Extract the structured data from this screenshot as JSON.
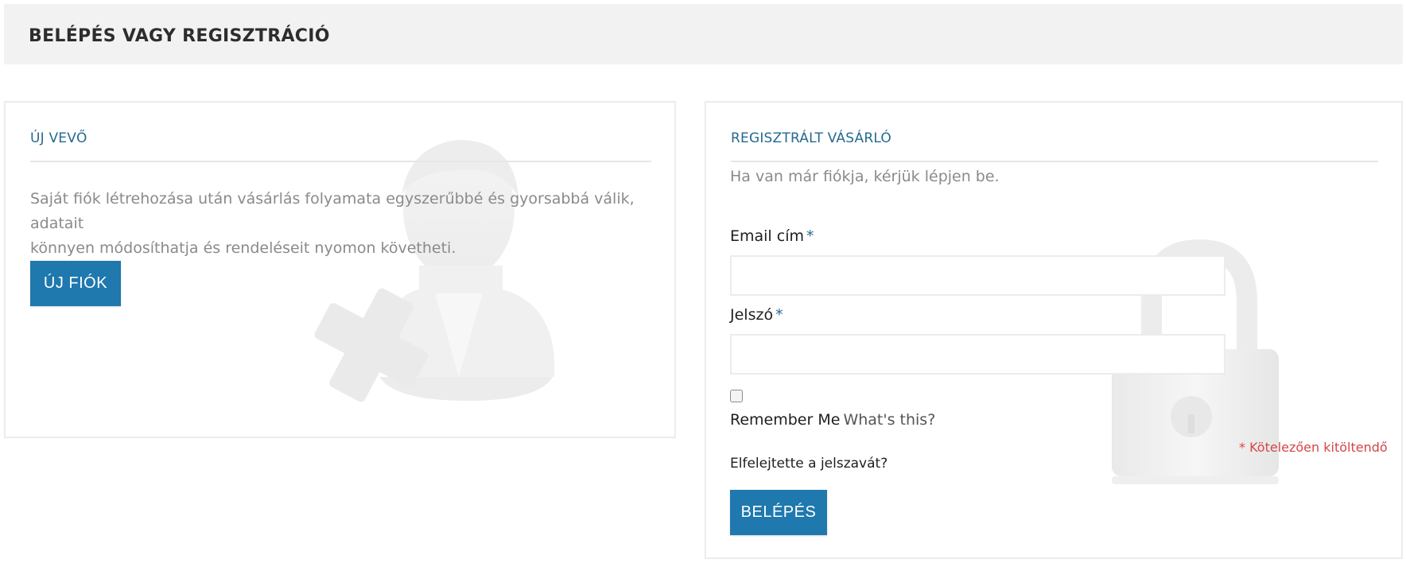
{
  "header": {
    "title": "BELÉPÉS VAGY REGISZTRÁCIÓ"
  },
  "new_customer": {
    "title": "ÚJ VEVŐ",
    "description_line1": "Saját fiók létrehozása után vásárlás folyamata egyszerűbbé és gyorsabbá válik, adatait",
    "description_line2": "könnyen módosíthatja és rendeléseit nyomon követheti.",
    "button_label": "ÚJ FIÓK",
    "watermark_icon": "add-user-icon"
  },
  "registered_customer": {
    "title": "REGISZTRÁLT VÁSÁRLÓ",
    "intro": "Ha van már fiókja, kérjük lépjen be.",
    "email_label": "Email cím",
    "email_value": "",
    "password_label": "Jelszó",
    "password_value": "",
    "required_mark": "*",
    "remember_label": "Remember Me",
    "whats_this": "What's this?",
    "required_note": "* Kötelezően kitöltendő",
    "forgot_password": "Elfelejtette a jelszavát?",
    "login_button": "BELÉPÉS",
    "watermark_icon": "padlock-icon"
  },
  "colors": {
    "accent": "#1f78ae",
    "title_blue": "#246a90",
    "required_red": "#d64545",
    "header_bg": "#f2f2f2"
  }
}
